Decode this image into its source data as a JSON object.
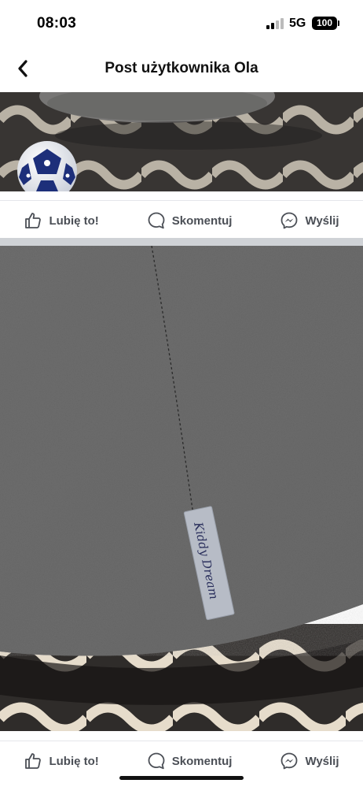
{
  "status_bar": {
    "time": "08:03",
    "network": "5G",
    "battery": "100"
  },
  "header": {
    "title": "Post użytkownika Ola",
    "back_icon": "chevron-left-icon"
  },
  "post_actions": {
    "like_label": "Lubię to!",
    "comment_label": "Skomentuj",
    "share_label": "Wyślij",
    "like_icon": "thumbs-up-icon",
    "comment_icon": "speech-bubble-icon",
    "share_icon": "messenger-icon"
  },
  "photo_2": {
    "tag_text": "Kiddy Dream"
  },
  "colors": {
    "action_text": "#4b4f56",
    "divider": "#cfd2d6",
    "fabric": "#6e6e6e"
  }
}
